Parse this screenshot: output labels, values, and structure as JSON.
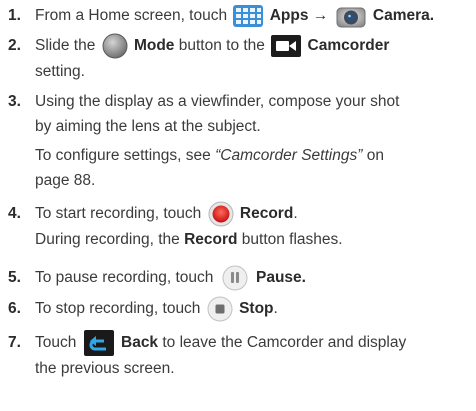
{
  "steps": [
    {
      "number": "1.",
      "before": "From a Home screen, touch",
      "apps": "Apps",
      "arrow": "→",
      "camera": "Camera."
    },
    {
      "number": "2.",
      "before": "Slide the",
      "mode": "Mode",
      "middle": "button to the",
      "camcorder": "Camcorder",
      "after": "setting."
    },
    {
      "number": "3.",
      "line1": "Using the display as a viewfinder, compose your shot",
      "line2": "by aiming the lens at the subject.",
      "note_before": "To configure settings, see",
      "note_link": "“Camcorder Settings”",
      "note_after": "on",
      "note_line2": "page 88."
    },
    {
      "number": "4.",
      "before": "To start recording, touch",
      "record": "Record",
      "period": ".",
      "note_before": "During recording, the",
      "note_record": "Record",
      "note_after": "button flashes."
    },
    {
      "number": "5.",
      "before": "To pause recording, touch",
      "pause": "Pause."
    },
    {
      "number": "6.",
      "before": "To stop recording, touch",
      "stop": "Stop",
      "period": "."
    },
    {
      "number": "7.",
      "before": "Touch",
      "back": "Back",
      "after": "to leave the Camcorder and display",
      "line2": "the previous screen."
    }
  ],
  "colors": {
    "text": "#3b3b3b",
    "apps_icon": "#3a8fd8",
    "record_red": "#e02020",
    "icon_gray": "#8a8a8a",
    "back_bg": "#1a1a1a",
    "back_arrow": "#2fa8e8"
  }
}
